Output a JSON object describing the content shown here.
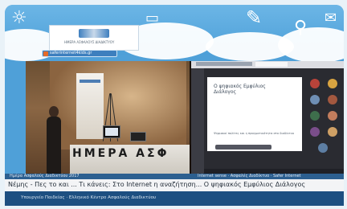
{
  "banner": {
    "logo_text": "ΗΜΕΡΑ ΑΣΦΑΛΟΥΣ ΔΙΑΔΙΚΤΥΟΥ",
    "url_text": "saferinternet4kids.gr"
  },
  "video": {
    "desk_text": "ΗΜΕΡΑ ΑΣΦ",
    "slide_title": "Ο ψηφιακός Εμφύλιος Διάλογος",
    "slide_body": "Ψηφιακοί πολίτες και η πραγματικότητα στο διαδίκτυο"
  },
  "ticker": {
    "left_text": "Ημέρα Ασφαλούς Διαδικτύου 2017",
    "right_text": "Internet sense · Ασφαλές Διαδίκτυο · Safer Internet"
  },
  "caption": {
    "text": "Νέμης - Πες το και ... Τι κάνεις: Στο Internet η αναζήτηση... Ο ψηφιακός Εμφύλιος Διάλογος"
  },
  "footer": {
    "text": "Υπουργείο Παιδείας · Ελληνικό Κέντρο Ασφαλούς Διαδικτύου"
  },
  "colors": {
    "frame": "#4fa0d8",
    "footer": "#1d4f81",
    "ticker": "#2c5f90"
  }
}
